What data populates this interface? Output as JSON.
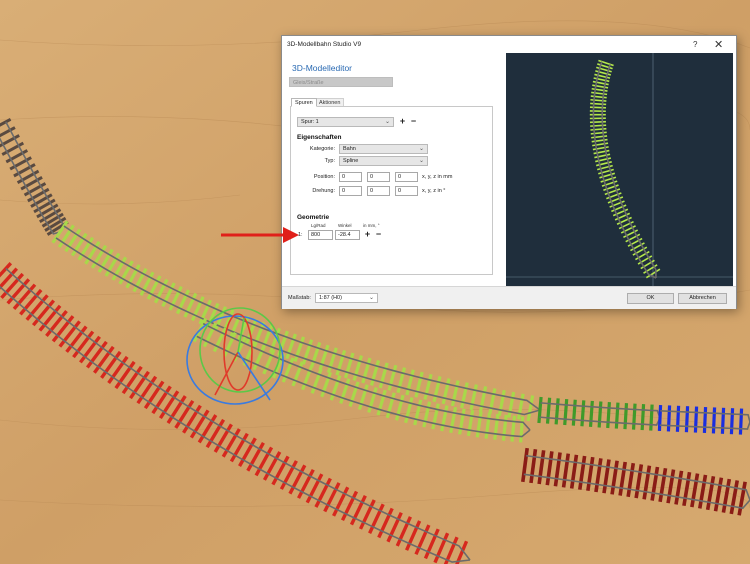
{
  "window": {
    "title": "3D-Modellbahn Studio V9",
    "help_glyph": "?",
    "close_glyph": "✕"
  },
  "editor": {
    "heading": "3D-Modelleditor",
    "gleis_field": "Gleis/Straße",
    "tabs": [
      {
        "label": "Spuren",
        "active": true
      },
      {
        "label": "Aktionen",
        "active": false
      }
    ],
    "spur_select": "Spur: 1",
    "add_glyph": "+",
    "remove_glyph": "−",
    "properties_heading": "Eigenschaften",
    "kategorie_label": "Kategorie:",
    "kategorie_value": "Bahn",
    "typ_label": "Typ:",
    "typ_value": "Spline",
    "position_label": "Position:",
    "position_values": [
      "0",
      "0",
      "0"
    ],
    "position_unit": "x, y, z in mm",
    "drehung_label": "Drehung:",
    "drehung_values": [
      "0",
      "0",
      "0"
    ],
    "drehung_unit": "x, y, z in °",
    "geometry_heading": "Geometrie",
    "col_length": "Lg/Rad",
    "col_angle": "Winkel",
    "col_unit": "in mm, °",
    "row_label": "1:",
    "length_value": "800",
    "angle_value": "-28.4"
  },
  "footer": {
    "scale_label": "Maßstab:",
    "scale_value": "1:87 (H0)",
    "ok_label": "OK",
    "cancel_label": "Abbrechen"
  },
  "colors": {
    "wood": "#d2a46c",
    "track_green_light": "#a8d84a",
    "track_green_dark": "#3f9a2a",
    "track_red": "#d6281e",
    "track_dark_red": "#8a1c16",
    "track_blue": "#1a2ee0",
    "track_brown": "#5a4a40",
    "preview_bg": "#1f2e3c",
    "accent_heading": "#2a6ab3",
    "arrow_red": "#e0201a"
  },
  "icons": [
    "chevron-down-icon",
    "plus-icon",
    "minus-icon",
    "help-icon",
    "close-icon",
    "gizmo-icon",
    "arrow-icon"
  ]
}
